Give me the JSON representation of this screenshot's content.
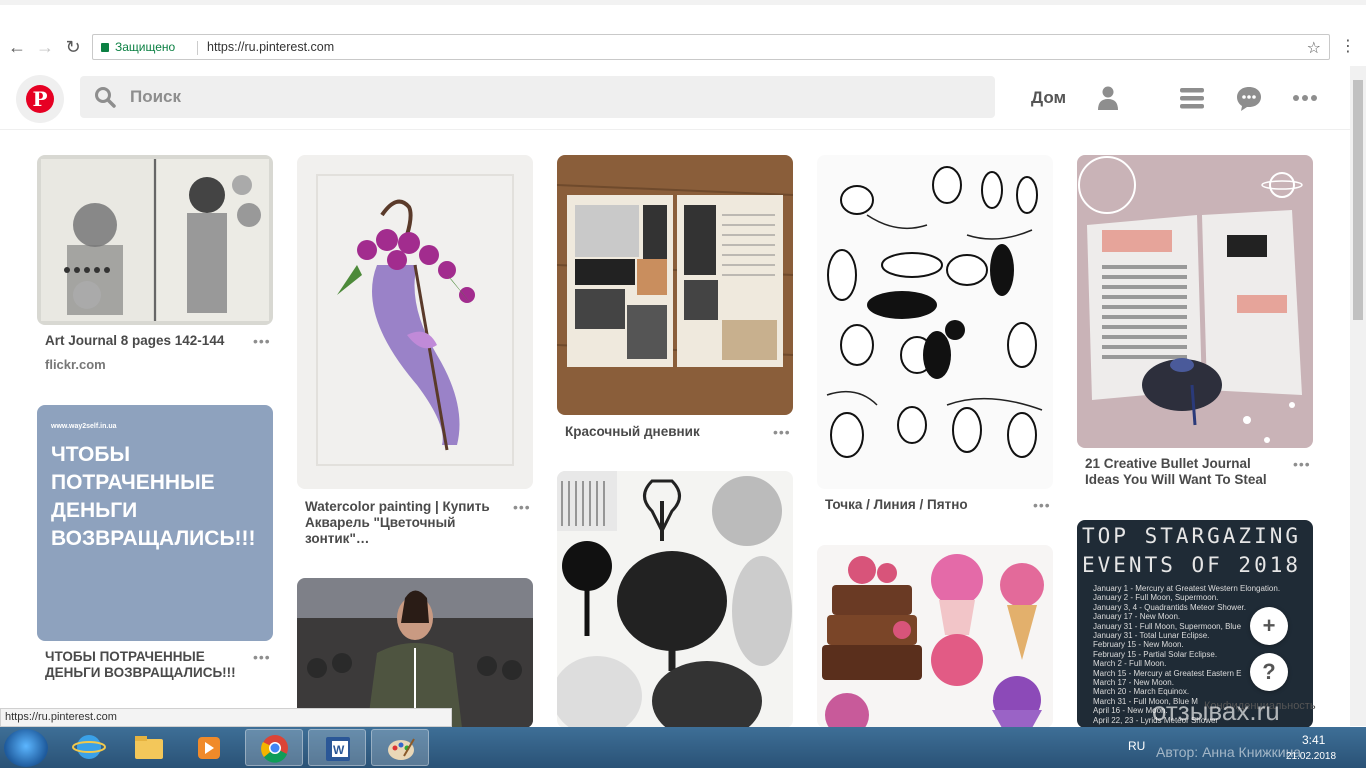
{
  "browser": {
    "secure_label": "Защищено",
    "url": "https://ru.pinterest.com",
    "status_url": "https://ru.pinterest.com"
  },
  "header": {
    "search_placeholder": "Поиск",
    "home_label": "Дом"
  },
  "pins": [
    {
      "title": "Art Journal 8 pages 142-144",
      "source": "flickr.com"
    },
    {
      "title": "ЧТОБЫ ПОТРАЧЕННЫЕ ДЕНЬГИ ВОЗВРАЩАЛИСЬ!!!",
      "image_text": "ЧТОБЫ ПОТРАЧЕННЫЕ ДЕНЬГИ ВОЗВРАЩАЛИСЬ!!!",
      "image_small": "www.way2self.in.ua"
    },
    {
      "title": "Watercolor painting | Купить Акварель \"Цветочный зонтик\"…"
    },
    {
      "title": "Красочный дневник"
    },
    {
      "title": "Точка / Линия / Пятно"
    },
    {
      "title": "21 Creative Bullet Journal Ideas You Will Want To Steal"
    },
    {
      "image_title_1": "TOP STARGAZING",
      "image_title_2": "EVENTS OF 2018",
      "events": [
        "January 1 - Mercury at Greatest Western Elongation.",
        "January 2 - Full Moon, Supermoon.",
        "January 3, 4 - Quadrantids Meteor Shower.",
        "January 17 - New Moon.",
        "January 31 - Full Moon, Supermoon, Blue",
        "January 31 - Total Lunar Eclipse.",
        "February 15 - New Moon.",
        "February 15 - Partial Solar Eclipse.",
        "March 2 - Full Moon.",
        "March 15 - Mercury at Greatest Eastern E",
        "March 17 - New Moon.",
        "March 20 - March Equinox.",
        "March 31 - Full Moon, Blue M",
        "April 16 - New Moon.",
        "April 22, 23 - Lyrids Meteor Shower"
      ]
    }
  ],
  "more_label": "•••",
  "fab": {
    "plus": "+",
    "help": "?"
  },
  "privacy": "Конфиденциальность",
  "taskbar": {
    "lang": "RU",
    "time": "3:41",
    "date": "21.02.2018"
  },
  "watermark": {
    "main": "отзывах.ru",
    "author": "Автор: Анна Книжкина"
  },
  "colors": {
    "pinterest_red": "#e60023",
    "secure_green": "#0b8043",
    "taskbar": "#2f5a80"
  }
}
